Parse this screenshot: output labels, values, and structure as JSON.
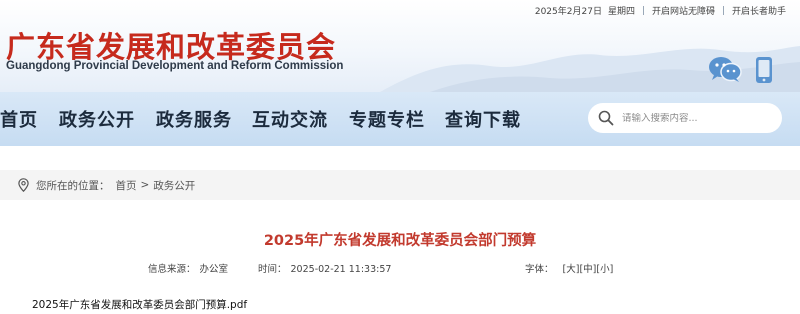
{
  "topbar": {
    "date": "2025年2月27日",
    "weekday": "星期四",
    "accessibility_link": "开启网站无障碍",
    "elder_link": "开启长者助手"
  },
  "header": {
    "title": "广东省发展和改革委员会",
    "subtitle": "Guangdong Provincial Development and Reform Commission",
    "icons": [
      "wechat-icon",
      "mobile-icon"
    ]
  },
  "nav": {
    "items": [
      {
        "label": "首页"
      },
      {
        "label": "政务公开"
      },
      {
        "label": "政务服务"
      },
      {
        "label": "互动交流"
      },
      {
        "label": "专题专栏"
      },
      {
        "label": "查询下载"
      }
    ],
    "search_placeholder": "请输入搜索内容..."
  },
  "breadcrumb": {
    "prefix": "您所在的位置：",
    "items": [
      "首页",
      "政务公开"
    ],
    "separator": ">"
  },
  "article": {
    "title": "2025年广东省发展和改革委员会部门预算",
    "source_label": "信息来源：",
    "source": "办公室",
    "time_label": "时间：",
    "time": "2025-02-21 11:33:57",
    "font_label": "字体：",
    "font_sizes": [
      "[大]",
      "[中]",
      "[小]"
    ],
    "attachment": "2025年广东省发展和改革委员会部门预算.pdf"
  },
  "colors": {
    "brand_red": "#c62a1d",
    "title_red": "#c23a2e",
    "nav_bg": "#cfe1f4"
  }
}
